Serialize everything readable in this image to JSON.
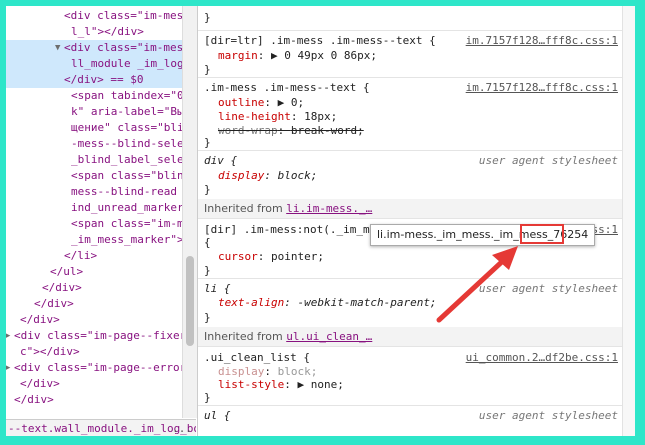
{
  "elements_tree": [
    {
      "t": "<div class=\"im-mess-",
      "indent": 50
    },
    {
      "t": "l_l\"></div>",
      "indent": 57
    },
    {
      "t": "<div class=\"im-mess-",
      "indent": 50,
      "sel": true,
      "tri": "▼"
    },
    {
      "t": "ll_module _im_log_body",
      "indent": 57,
      "sel": true
    },
    {
      "t": "</div> == $0",
      "indent": 50,
      "sel": true
    },
    {
      "t": "<span tabindex=\"0\" r",
      "indent": 57
    },
    {
      "t": "k\" aria-label=\"Выдел",
      "indent": 57
    },
    {
      "t": "щение\" class=\"blind_",
      "indent": 57
    },
    {
      "t": "-mess--blind-select ",
      "indent": 57
    },
    {
      "t": "_blind_label_select\"",
      "indent": 57
    },
    {
      "t": "<span class=\"blind_l",
      "indent": 57
    },
    {
      "t": "mess--blind-read _im",
      "indent": 57
    },
    {
      "t": "ind_unread_marker\"><",
      "indent": 57
    },
    {
      "t": "<span class=\"im-mess",
      "indent": 57
    },
    {
      "t": "_im_mess_marker\"></s",
      "indent": 57
    },
    {
      "t": "</li>",
      "indent": 50
    },
    {
      "t": "</ul>",
      "indent": 36
    },
    {
      "t": "</div>",
      "indent": 28
    },
    {
      "t": "</div>",
      "indent": 20
    },
    {
      "t": "</div>",
      "indent": 6
    },
    {
      "t": "<div class=\"im-page--fixer _i",
      "indent": 0,
      "tri": "▶"
    },
    {
      "t": "c\"></div>",
      "indent": 6
    },
    {
      "t": "<div class=\"im-page--error _i",
      "indent": 0,
      "tri": "▶"
    },
    {
      "t": "</div>",
      "indent": 6
    },
    {
      "t": "</div>",
      "indent": 0
    }
  ],
  "breadcrumb": {
    "label": "--text.wall_module._im_log_body",
    "more": "..."
  },
  "rules": {
    "r1": {
      "close": "}"
    },
    "r2": {
      "selector": "[dir=ltr] .im-mess .im-mess--text {",
      "source": "im.7157f128…fff8c.css:1",
      "p1_name": "margin",
      "p1_value": "▶ 0 49px 0 86px;",
      "close": "}"
    },
    "r3": {
      "selector": ".im-mess .im-mess--text {",
      "source": "im.7157f128…fff8c.css:1",
      "p1_name": "outline",
      "p1_value": "▶ 0;",
      "p2_name": "line-height",
      "p2_value": "18px;",
      "p3_name": "word-wrap",
      "p3_value": "break-word;",
      "close": "}"
    },
    "r4": {
      "selector": "div {",
      "source": "user agent stylesheet",
      "p1_name": "display",
      "p1_value": "block;",
      "close": "}"
    },
    "inh1": {
      "label": "Inherited from ",
      "from": "li.im-mess._…"
    },
    "r5": {
      "selector": "[dir] .im-mess:not(._im_mess",
      "source": "f8c.css:1",
      "open": "{",
      "p1_name": "cursor",
      "p1_value": "pointer;",
      "close": "}"
    },
    "r6": {
      "selector": "li {",
      "source": "user agent stylesheet",
      "p1_name": "text-align",
      "p1_value": "-webkit-match-parent;",
      "close": "}"
    },
    "inh2": {
      "label": "Inherited from ",
      "from": "ul.ui_clean_…"
    },
    "r7": {
      "selector": ".ui_clean_list {",
      "source": "ui_common.2…df2be.css:1",
      "p1_name": "display",
      "p1_value": "block;",
      "p2_name": "list-style",
      "p2_value": "▶ none;",
      "close": "}"
    },
    "r8": {
      "selector": "ul {",
      "source": "user agent stylesheet"
    }
  },
  "tooltip": {
    "prefix": "li.im-mess._im_mess._im_mess",
    "highlight": "_76254"
  },
  "colors": {
    "frame_bg": "#2ee6c9",
    "annotation": "#e53935"
  }
}
